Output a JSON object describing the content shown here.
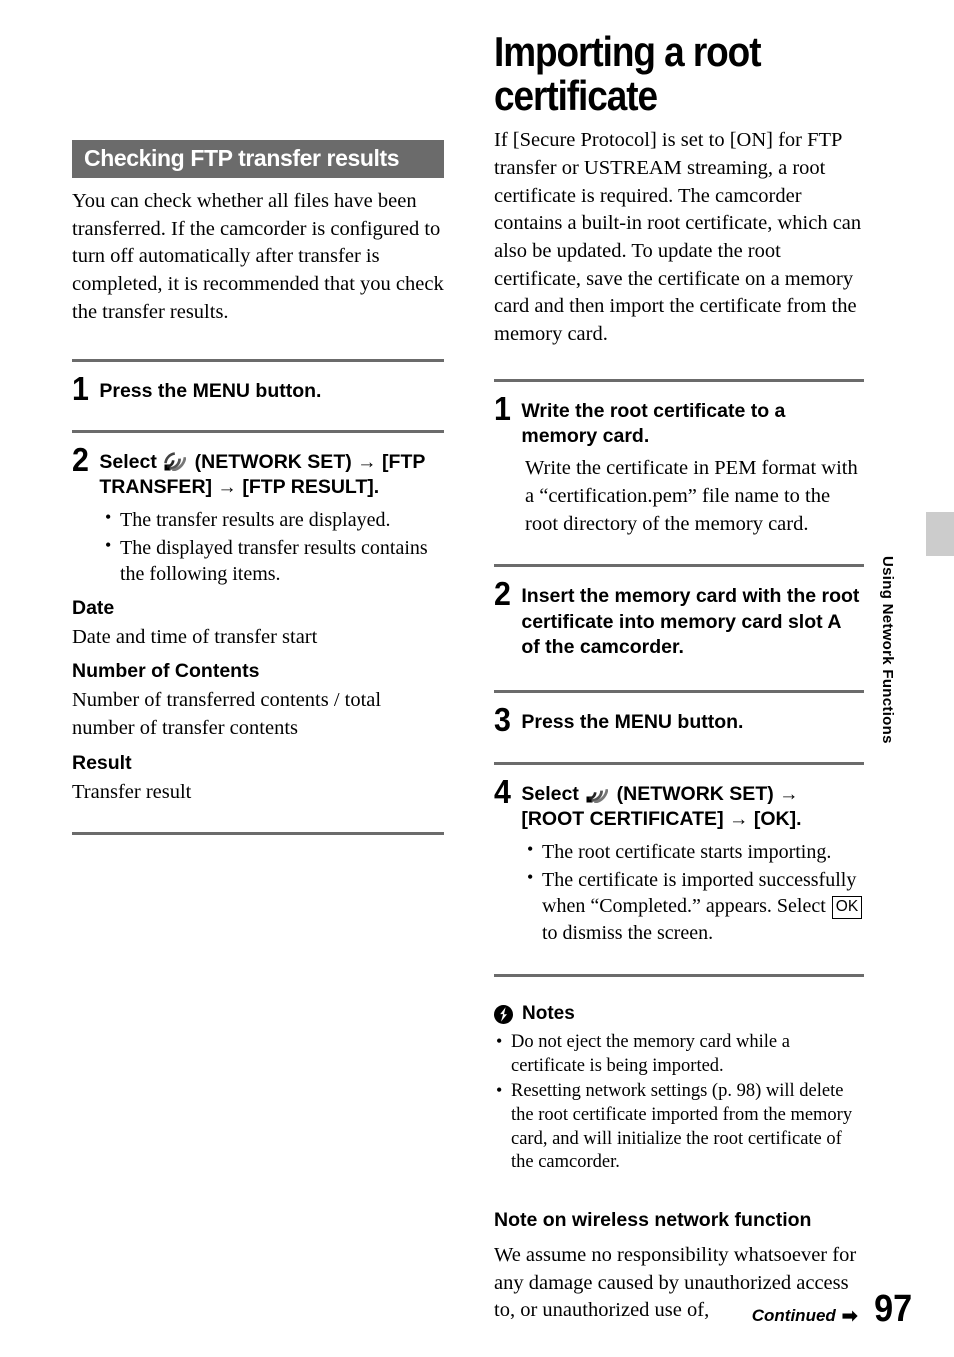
{
  "left_column": {
    "section_header": "Checking FTP transfer results",
    "intro": "You can check whether all files have been transferred. If the camcorder is configured to turn off automatically after transfer is completed, it is recommended that you check the transfer results.",
    "steps": [
      {
        "number": "1",
        "text": "Press the MENU button."
      },
      {
        "number": "2",
        "text_before_icon": "Select ",
        "icon": "network-signal-icon",
        "text_after_icon": " (NETWORK SET) → [FTP TRANSFER] → [FTP RESULT].",
        "bullets": [
          "The transfer results are displayed.",
          "The displayed transfer results contains the following items."
        ],
        "definitions": [
          {
            "term": "Date",
            "desc": "Date and time of transfer start"
          },
          {
            "term": "Number of Contents",
            "desc": "Number of transferred contents / total number of transfer contents"
          },
          {
            "term": "Result",
            "desc": "Transfer result"
          }
        ]
      }
    ]
  },
  "right_column": {
    "chapter_title": "Importing a root certificate",
    "intro": "If [Secure Protocol] is set to [ON] for FTP transfer or USTREAM streaming, a root certificate is required. The camcorder contains a built-in root certificate, which can also be updated. To update the root certificate, save the certificate on a memory card and then import the certificate from the memory card.",
    "steps": [
      {
        "number": "1",
        "text": "Write the root certificate to a memory card.",
        "body": "Write the certificate in PEM format with a “certification.pem” file name to the root directory of the memory card."
      },
      {
        "number": "2",
        "text": "Insert the memory card with the root certificate into memory card slot A of the camcorder."
      },
      {
        "number": "3",
        "text": "Press the MENU button."
      },
      {
        "number": "4",
        "text_before_icon": "Select ",
        "icon": "network-signal-icon",
        "text_after_icon": " (NETWORK SET) → [ROOT CERTIFICATE] → [OK].",
        "bullet_1": "The root certificate starts importing.",
        "bullet_2_part1": "The certificate is imported successfully when “Completed.” appears. Select ",
        "bullet_2_key": "OK",
        "bullet_2_part2": " to dismiss the screen."
      }
    ],
    "notes": {
      "icon": "notes-bolt-icon",
      "heading": "Notes",
      "items": [
        "Do not eject the memory card while a certificate is being imported.",
        "Resetting network settings (p. 98) will delete the root certificate imported from the memory card, and will initialize the root certificate of the camcorder."
      ]
    },
    "note_wireless": {
      "heading": "Note on wireless network function",
      "text": "We assume no responsibility whatsoever for any damage caused by unauthorized access to, or unauthorized use of,"
    }
  },
  "side_tab": {
    "label": "Using Network Functions",
    "color": "#cccccc"
  },
  "footer": {
    "continued": "Continued",
    "arrow": "➡",
    "page_number": "97"
  },
  "colors": {
    "section_bar": "#6b6b6b",
    "rule": "#6b6b6b",
    "tab": "#cccccc"
  }
}
